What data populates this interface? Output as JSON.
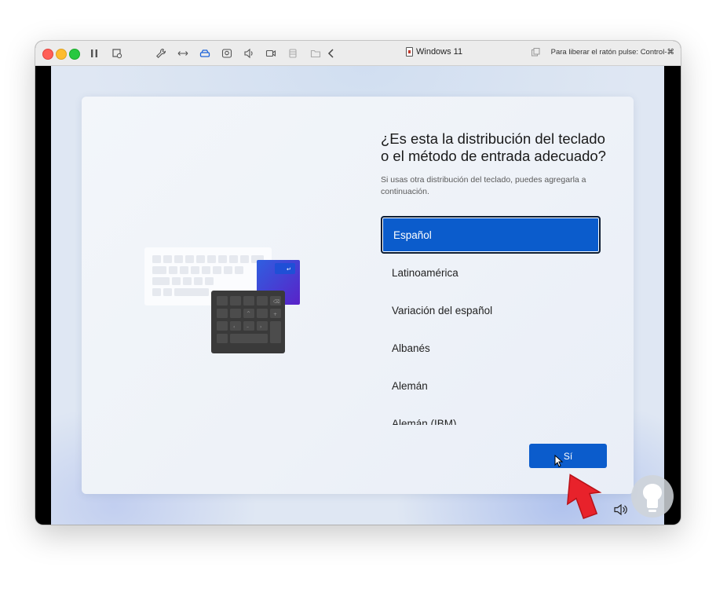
{
  "window": {
    "title": "Windows 11",
    "mouse_hint": "Para liberar el ratón pulse: Control-⌘"
  },
  "toolbar": {
    "icons": [
      "pause-icon",
      "snapshot-icon",
      "wrench-icon",
      "resize-icon",
      "hard-drive-icon",
      "camera-icon",
      "speaker-icon",
      "video-icon",
      "usb-icon",
      "folder-icon",
      "back-chevron-icon",
      "copy-icon"
    ]
  },
  "setup": {
    "heading": "¿Es esta la distribución del teclado o el método de entrada adecuado?",
    "subtext": "Si usas otra distribución del teclado, puedes agregarla a continuación.",
    "options": [
      "Español",
      "Latinoamérica",
      "Variación del español",
      "Albanés",
      "Alemán",
      "Alemán (IBM)"
    ],
    "selected_option": "Español",
    "next_button": "Sí"
  },
  "colors": {
    "accent": "#0b5ccc",
    "annotation_arrow": "#e8222b"
  }
}
